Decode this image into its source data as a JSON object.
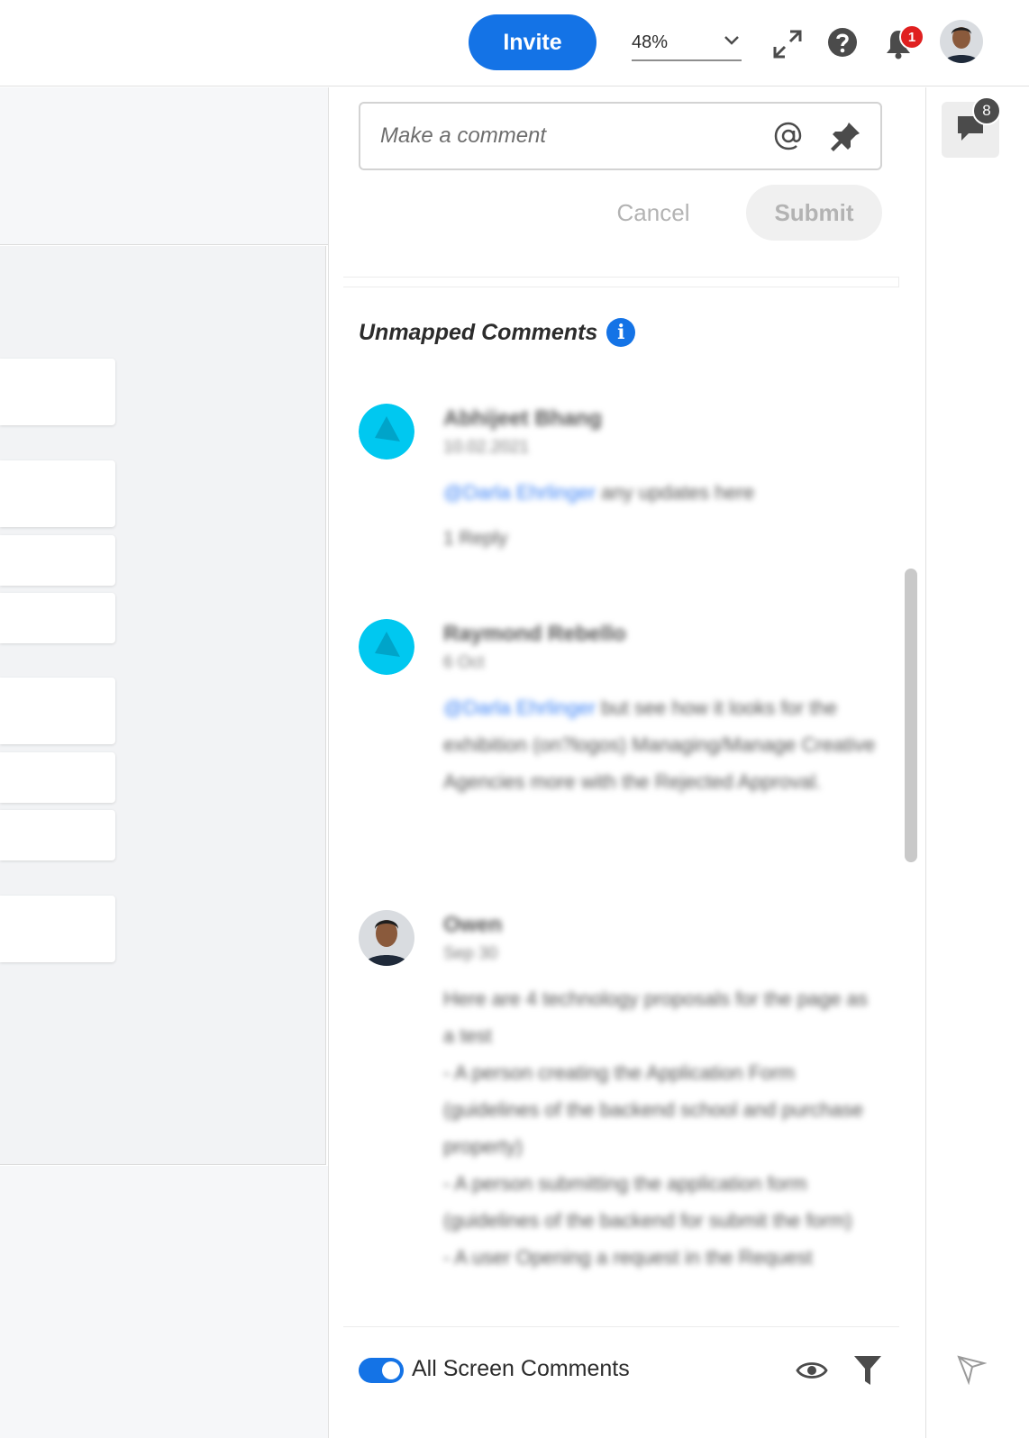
{
  "header": {
    "invite_label": "Invite",
    "zoom_value": "48%",
    "notification_count": "1",
    "icons": [
      "expand-icon",
      "help-icon",
      "bell-icon",
      "chevron-down-icon"
    ]
  },
  "comment_form": {
    "placeholder": "Make a comment",
    "cancel_label": "Cancel",
    "submit_label": "Submit"
  },
  "comments_section": {
    "title": "Unmapped Comments",
    "info_glyph": "i",
    "comments": [
      {
        "author": "Abhijeet Bhang",
        "date": "10.02.2021",
        "mention": "@Darla Ehrlinger",
        "text": " any updates here",
        "reply": "1 Reply"
      },
      {
        "author": "Raymond Rebello",
        "date": "6 Oct",
        "mention": "@Darla Ehrlinger",
        "text": " but see how it looks for the exhibition (on?logos) Managing/Manage Creative Agencies more with the Rejected Approval."
      },
      {
        "author": "Owen",
        "date": "Sep 30",
        "text": "Here are 4 technology proposals for the page as a test\n- A person creating the Application Form (guidelines of the backend school and purchase property)\n- A person submitting the application form (guidelines of the backend for submit the form)\n- A user Opening a request in the Request"
      }
    ]
  },
  "footer": {
    "toggle_on": true,
    "toggle_label": "All Screen Comments",
    "icons": [
      "eye-icon",
      "filter-icon"
    ]
  },
  "rail": {
    "comments_count": "8",
    "icons": [
      "comments-icon",
      "pointer-flag-icon"
    ]
  },
  "colors": {
    "accent": "#1473e6",
    "badge_red": "#e02020",
    "bot_avatar": "#00c8f0"
  }
}
